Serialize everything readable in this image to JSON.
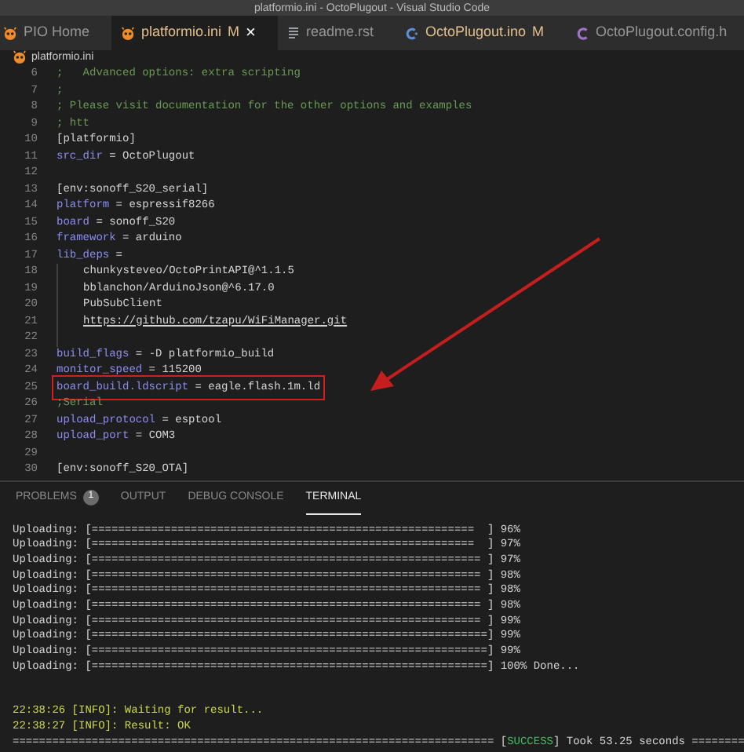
{
  "window": {
    "title": "platformio.ini - OctoPlugout - Visual Studio Code"
  },
  "tabs": [
    {
      "label": "PIO Home",
      "kind": "pio",
      "selected": false,
      "modified": false
    },
    {
      "label": "platformio.ini",
      "kind": "pio",
      "selected": true,
      "modified": true,
      "badge": "M",
      "close": "×"
    },
    {
      "label": "readme.rst",
      "kind": "doc",
      "selected": false,
      "modified": false
    },
    {
      "label": "OctoPlugout.ino",
      "kind": "cpp",
      "selected": false,
      "modified": true,
      "badge": "M"
    },
    {
      "label": "OctoPlugout.config.h",
      "kind": "c",
      "selected": false,
      "modified": false
    }
  ],
  "breadcrumb": "platformio.ini",
  "code_lines": [
    {
      "number": "6",
      "indented": false,
      "boxed": false,
      "tokens": [
        {
          "kind": "comment",
          "text": ";   Advanced options: extra scripting"
        }
      ]
    },
    {
      "number": "7",
      "indented": false,
      "boxed": false,
      "tokens": [
        {
          "kind": "comment",
          "text": ";"
        }
      ]
    },
    {
      "number": "8",
      "indented": false,
      "boxed": false,
      "tokens": [
        {
          "kind": "comment",
          "text": "; Please visit documentation for the other options and examples"
        }
      ]
    },
    {
      "number": "9",
      "indented": false,
      "boxed": false,
      "tokens": [
        {
          "kind": "comment",
          "text": "; htt"
        }
      ]
    },
    {
      "number": "10",
      "indented": false,
      "boxed": false,
      "tokens": [
        {
          "kind": "plain",
          "text": "[platformio]"
        }
      ]
    },
    {
      "number": "11",
      "indented": false,
      "boxed": false,
      "tokens": [
        {
          "kind": "key",
          "text": "src_dir"
        },
        {
          "kind": "plain",
          "text": " = OctoPlugout"
        }
      ]
    },
    {
      "number": "12",
      "indented": false,
      "boxed": false
    },
    {
      "number": "13",
      "indented": false,
      "boxed": false,
      "tokens": [
        {
          "kind": "plain",
          "text": "[env:sonoff_S20_serial]"
        }
      ]
    },
    {
      "number": "14",
      "indented": false,
      "boxed": false,
      "tokens": [
        {
          "kind": "key",
          "text": "platform"
        },
        {
          "kind": "plain",
          "text": " = espressif8266"
        }
      ]
    },
    {
      "number": "15",
      "indented": false,
      "boxed": false,
      "tokens": [
        {
          "kind": "key",
          "text": "board"
        },
        {
          "kind": "plain",
          "text": " = sonoff_S20"
        }
      ]
    },
    {
      "number": "16",
      "indented": false,
      "boxed": false,
      "tokens": [
        {
          "kind": "key",
          "text": "framework"
        },
        {
          "kind": "plain",
          "text": " = arduino"
        }
      ]
    },
    {
      "number": "17",
      "indented": false,
      "boxed": false,
      "tokens": [
        {
          "kind": "key",
          "text": "lib_deps"
        },
        {
          "kind": "plain",
          "text": " ="
        }
      ]
    },
    {
      "number": "18",
      "indented": true,
      "boxed": false,
      "tokens": [
        {
          "kind": "plain",
          "text": "chunkysteveo/OctoPrintAPI@^1.1.5"
        }
      ]
    },
    {
      "number": "19",
      "indented": true,
      "boxed": false,
      "tokens": [
        {
          "kind": "plain",
          "text": "bblanchon/ArduinoJson@^6.17.0"
        }
      ]
    },
    {
      "number": "20",
      "indented": true,
      "boxed": false,
      "tokens": [
        {
          "kind": "plain",
          "text": "PubSubClient"
        }
      ]
    },
    {
      "number": "21",
      "indented": true,
      "boxed": false,
      "tokens": [
        {
          "kind": "link",
          "text": "https://github.com/tzapu/WiFiManager.git"
        }
      ]
    },
    {
      "number": "22",
      "indented": true,
      "boxed": false
    },
    {
      "number": "23",
      "indented": false,
      "boxed": false,
      "tokens": [
        {
          "kind": "key",
          "text": "build_flags"
        },
        {
          "kind": "plain",
          "text": " = -D platformio_build"
        }
      ]
    },
    {
      "number": "24",
      "indented": false,
      "boxed": false,
      "tokens": [
        {
          "kind": "key",
          "text": "monitor_speed"
        },
        {
          "kind": "plain",
          "text": " = 115200"
        }
      ]
    },
    {
      "number": "25",
      "indented": false,
      "boxed": true,
      "tokens": [
        {
          "kind": "key",
          "text": "board_build.ldscript"
        },
        {
          "kind": "plain",
          "text": " = eagle.flash.1m.ld"
        }
      ]
    },
    {
      "number": "26",
      "indented": false,
      "boxed": false,
      "tokens": [
        {
          "kind": "comment",
          "text": ";Serial"
        }
      ]
    },
    {
      "number": "27",
      "indented": false,
      "boxed": false,
      "tokens": [
        {
          "kind": "key",
          "text": "upload_protocol"
        },
        {
          "kind": "plain",
          "text": " = esptool"
        }
      ]
    },
    {
      "number": "28",
      "indented": false,
      "boxed": false,
      "tokens": [
        {
          "kind": "key",
          "text": "upload_port"
        },
        {
          "kind": "plain",
          "text": " = COM3"
        }
      ]
    },
    {
      "number": "29",
      "indented": false,
      "boxed": false
    },
    {
      "number": "30",
      "indented": false,
      "boxed": false,
      "tokens": [
        {
          "kind": "plain",
          "text": "[env:sonoff_S20_OTA]"
        }
      ]
    }
  ],
  "panel_tabs": [
    {
      "label": "PROBLEMS",
      "badge": "1",
      "selected": false
    },
    {
      "label": "OUTPUT",
      "selected": false
    },
    {
      "label": "DEBUG CONSOLE",
      "selected": false
    },
    {
      "label": "TERMINAL",
      "selected": true
    }
  ],
  "terminal_lines": [
    {
      "tokens": [
        {
          "kind": "plain",
          "text": "Uploading: [==========================================================  ] 96%"
        }
      ]
    },
    {
      "tokens": [
        {
          "kind": "plain",
          "text": "Uploading: [==========================================================  ] 97%"
        }
      ]
    },
    {
      "tokens": [
        {
          "kind": "plain",
          "text": "Uploading: [=========================================================== ] 97%"
        }
      ]
    },
    {
      "tokens": [
        {
          "kind": "plain",
          "text": "Uploading: [=========================================================== ] 98%"
        }
      ]
    },
    {
      "tokens": [
        {
          "kind": "plain",
          "text": "Uploading: [=========================================================== ] 98%"
        }
      ]
    },
    {
      "tokens": [
        {
          "kind": "plain",
          "text": "Uploading: [=========================================================== ] 98%"
        }
      ]
    },
    {
      "tokens": [
        {
          "kind": "plain",
          "text": "Uploading: [=========================================================== ] 99%"
        }
      ]
    },
    {
      "tokens": [
        {
          "kind": "plain",
          "text": "Uploading: [============================================================] 99%"
        }
      ]
    },
    {
      "tokens": [
        {
          "kind": "plain",
          "text": "Uploading: [============================================================] 99%"
        }
      ]
    },
    {
      "tokens": [
        {
          "kind": "plain",
          "text": "Uploading: [============================================================] 100% Done..."
        }
      ]
    }
  ],
  "result_lines": [
    {
      "tokens": [
        {
          "kind": "info",
          "text": "22:38:26 [INFO]: Waiting for result..."
        }
      ]
    },
    {
      "tokens": [
        {
          "kind": "info",
          "text": "22:38:27 [INFO]: Result: OK"
        }
      ]
    },
    {
      "tokens": [
        {
          "kind": "plain",
          "text": "========================================================================= ["
        },
        {
          "kind": "success",
          "text": "SUCCESS"
        },
        {
          "kind": "plain",
          "text": "] Took 53.25 seconds ========"
        }
      ]
    }
  ]
}
